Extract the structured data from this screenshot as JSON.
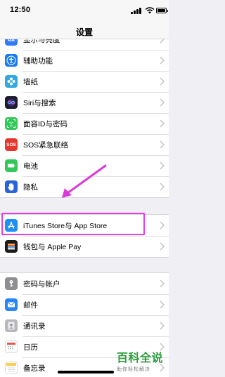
{
  "status_bar": {
    "time": "12:50"
  },
  "nav": {
    "title": "设置"
  },
  "group1": [
    {
      "label": "显示与亮度",
      "icon": "display-brightness-icon",
      "color": "#2f7cf6"
    },
    {
      "label": "辅助功能",
      "icon": "accessibility-icon",
      "color": "#1a7cf0"
    },
    {
      "label": "墙纸",
      "icon": "wallpaper-icon",
      "color": "#34a8e0"
    },
    {
      "label": "Siri与搜索",
      "icon": "siri-icon",
      "color": "#1c1c2e"
    },
    {
      "label": "面容ID与密码",
      "icon": "face-id-icon",
      "color": "#34c759"
    },
    {
      "label": "SOS紧急联络",
      "icon": "sos-icon",
      "color": "#e3372e",
      "icon_text": "SOS"
    },
    {
      "label": "电池",
      "icon": "battery-icon",
      "color": "#34c759"
    },
    {
      "label": "隐私",
      "icon": "privacy-hand-icon",
      "color": "#2a63d8"
    }
  ],
  "group2": [
    {
      "label": "iTunes Store与 App Store",
      "icon": "app-store-icon",
      "color": "#1d8ff5"
    },
    {
      "label": "钱包与 Apple Pay",
      "icon": "wallet-icon",
      "color": "#1b1b1b"
    }
  ],
  "group3": [
    {
      "label": "密码与帐户",
      "icon": "key-icon",
      "color": "#8e8e93"
    },
    {
      "label": "邮件",
      "icon": "mail-icon",
      "color": "#2a85f7"
    },
    {
      "label": "通讯录",
      "icon": "contacts-icon",
      "color": "#b7b7bc"
    },
    {
      "label": "日历",
      "icon": "calendar-icon",
      "color": "#ffffff"
    },
    {
      "label": "备忘录",
      "icon": "notes-icon",
      "color": "#ffffff"
    }
  ],
  "watermark": {
    "main": "百科全说",
    "sub": "助你轻松解决"
  },
  "colors": {
    "highlight": "#e83de8",
    "watermark": "#2a9d3a"
  }
}
